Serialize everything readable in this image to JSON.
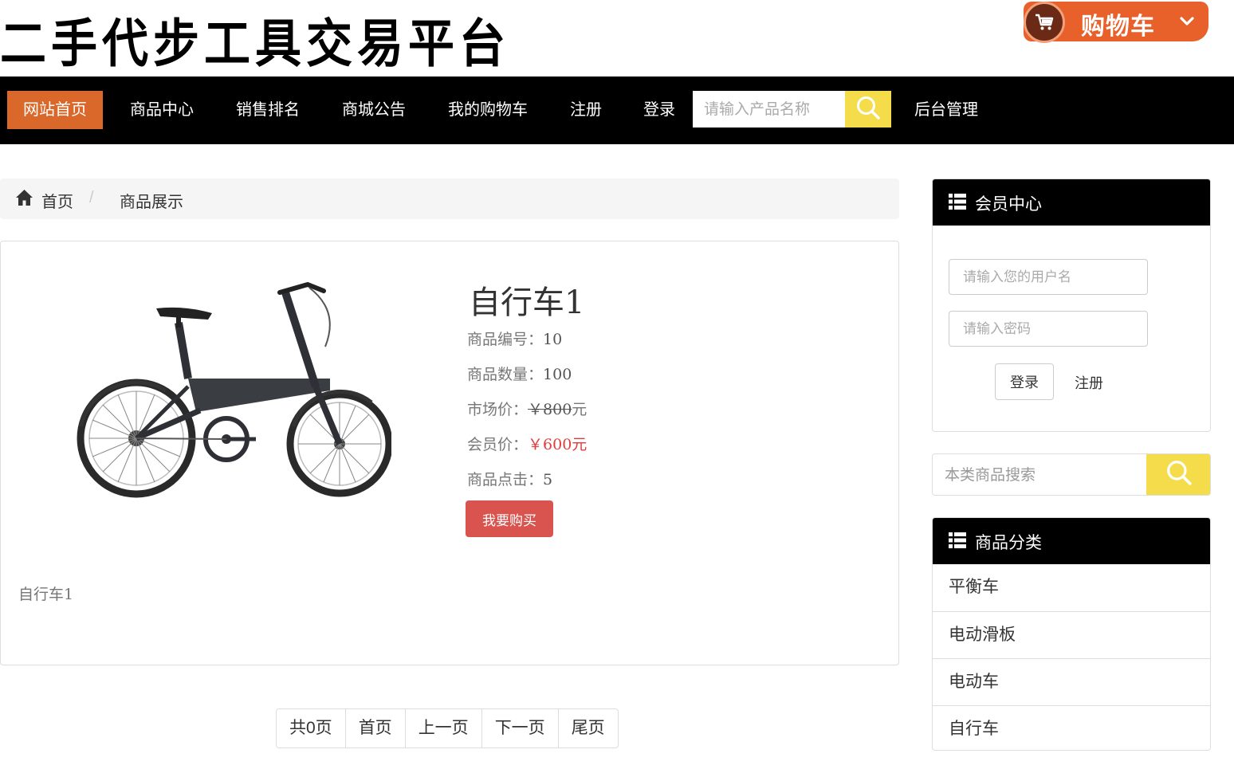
{
  "header": {
    "site_title": "二手代步工具交易平台",
    "cart_label": "购物车"
  },
  "nav": {
    "items": [
      {
        "label": "网站首页",
        "active": true
      },
      {
        "label": "商品中心"
      },
      {
        "label": "销售排名"
      },
      {
        "label": "商城公告"
      },
      {
        "label": "我的购物车"
      },
      {
        "label": "注册"
      },
      {
        "label": "登录"
      }
    ],
    "search_placeholder": "请输入产品名称",
    "admin_label": "后台管理"
  },
  "breadcrumb": {
    "home": "首页",
    "separator": "/",
    "current": "商品展示"
  },
  "product": {
    "name": "自行车1",
    "code_label": "商品编号：",
    "code": "10",
    "qty_label": "商品数量：",
    "qty": "100",
    "market_label": "市场价：",
    "market_price": "￥800",
    "market_unit": "元",
    "member_label": "会员价：",
    "member_price": "￥600元",
    "clicks_label": "商品点击：",
    "clicks": "5",
    "buy_label": "我要购买",
    "description": "自行车1"
  },
  "pagination": {
    "total": "共0页",
    "first": "首页",
    "prev": "上一页",
    "next": "下一页",
    "last": "尾页"
  },
  "member_center": {
    "title": "会员中心",
    "username_placeholder": "请输入您的用户名",
    "password_placeholder": "请输入密码",
    "login_label": "登录",
    "register_label": "注册"
  },
  "category_search": {
    "placeholder": "本类商品搜索"
  },
  "categories": {
    "title": "商品分类",
    "items": [
      "平衡车",
      "电动滑板",
      "电动车",
      "自行车"
    ]
  },
  "colors": {
    "accent_orange": "#d9682a",
    "search_yellow": "#f4dc4a",
    "buy_red": "#d9534f",
    "price_red": "#e23b3b"
  },
  "icons": [
    "cart-icon",
    "chevron-down-icon",
    "search-icon",
    "home-icon",
    "list-icon"
  ]
}
